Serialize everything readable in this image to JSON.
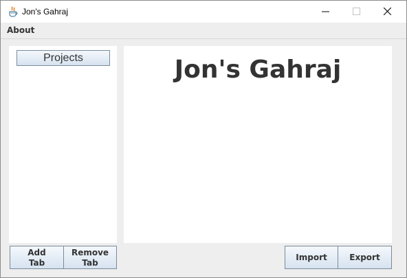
{
  "window": {
    "title": "Jon's Gahraj",
    "icon": "java-cup-icon",
    "controls": [
      "minimize-icon",
      "maximize-icon",
      "close-icon"
    ]
  },
  "menubar": {
    "items": [
      {
        "label": "About"
      }
    ]
  },
  "sidebar": {
    "projects_label": "Projects"
  },
  "main": {
    "heading": "Jon's Gahraj"
  },
  "buttons": {
    "add_tab_line1": "Add",
    "add_tab_line2": "Tab",
    "remove_tab_line1": "Remove",
    "remove_tab_line2": "Tab",
    "import": "Import",
    "export": "Export"
  },
  "colors": {
    "panel": "#ffffff",
    "background": "#eeeeee",
    "button_border": "#7a8a99",
    "text": "#333333"
  }
}
